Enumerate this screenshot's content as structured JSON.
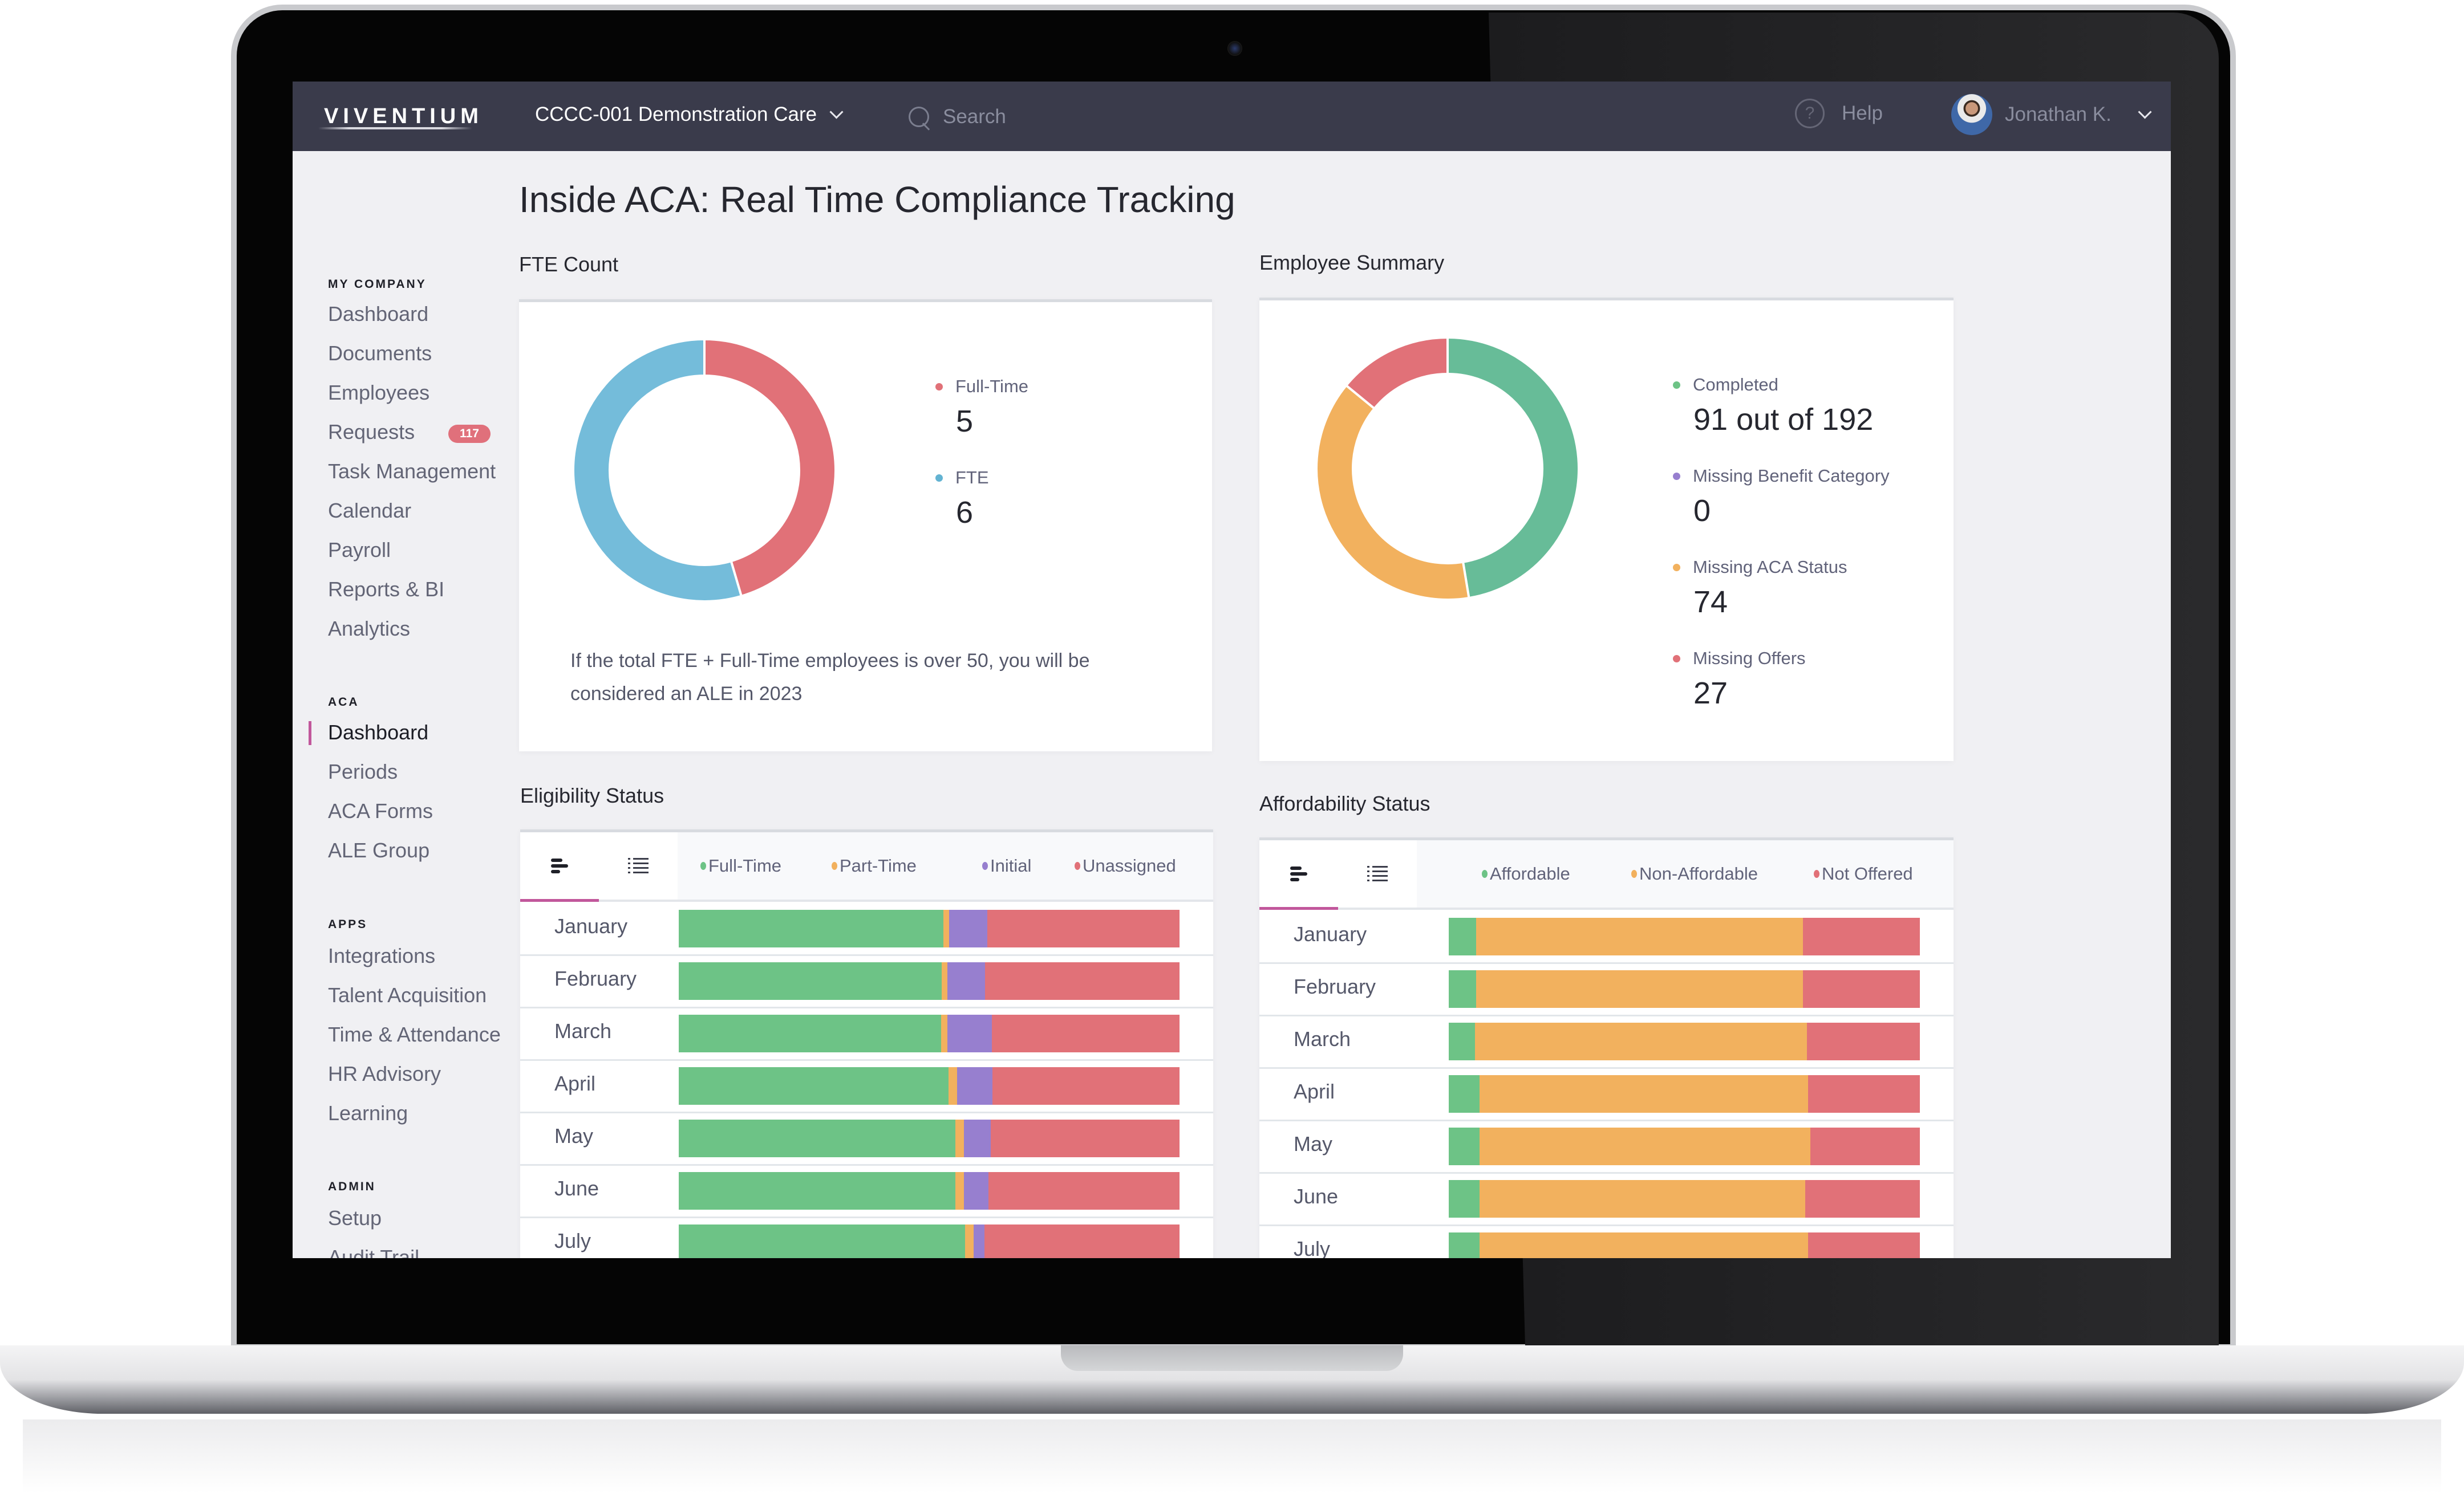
{
  "topnav": {
    "logo": "VIVENTIUM",
    "company": "CCCC-001 Demonstration Care",
    "search_placeholder": "Search",
    "help_label": "Help",
    "user_name": "Jonathan K."
  },
  "sidebar": {
    "sections": [
      {
        "title": "MY COMPANY",
        "items": [
          "Dashboard",
          "Documents",
          "Employees",
          "Requests",
          "Task Management",
          "Calendar",
          "Payroll",
          "Reports & BI",
          "Analytics"
        ]
      },
      {
        "title": "ACA",
        "items": [
          "Dashboard",
          "Periods",
          "ACA Forms",
          "ALE Group"
        ]
      },
      {
        "title": "APPS",
        "items": [
          "Integrations",
          "Talent Acquisition",
          "Time & Attendance",
          "HR Advisory",
          "Learning"
        ]
      },
      {
        "title": "ADMIN",
        "items": [
          "Setup",
          "Audit Trail"
        ]
      }
    ],
    "requests_badge": "117",
    "active_item": "ACA / Dashboard"
  },
  "page": {
    "title": "Inside ACA: Real Time Compliance Tracking"
  },
  "colors": {
    "accent": "#c1579b",
    "green": "#6dc386",
    "teal_green": "#67bc98",
    "orange": "#f2b15e",
    "purple": "#977fcf",
    "red": "#e17178",
    "blue": "#74bcda",
    "nav_bg": "#3a3b4b"
  },
  "fte_count": {
    "title": "FTE Count",
    "legend": [
      {
        "label": "Full-Time",
        "value": "5"
      },
      {
        "label": "FTE",
        "value": "6"
      }
    ],
    "note": "If the total FTE + Full-Time employees is over 50, you will be considered an ALE in 2023"
  },
  "employee_summary": {
    "title": "Employee Summary",
    "legend": [
      {
        "label": "Completed",
        "value": "91 out of 192"
      },
      {
        "label": "Missing Benefit Category",
        "value": "0"
      },
      {
        "label": "Missing ACA Status",
        "value": "74"
      },
      {
        "label": "Missing Offers",
        "value": "27"
      }
    ]
  },
  "eligibility": {
    "title": "Eligibility Status",
    "legend": [
      "Full-Time",
      "Part-Time",
      "Initial",
      "Unassigned"
    ]
  },
  "affordability": {
    "title": "Affordability Status",
    "legend": [
      "Affordable",
      "Non-Affordable",
      "Not Offered"
    ]
  },
  "chart_data": [
    {
      "type": "pie",
      "title": "FTE Count",
      "categories": [
        "Full-Time",
        "FTE"
      ],
      "values": [
        5,
        6
      ],
      "colors": [
        "#e17178",
        "#74bcda"
      ],
      "donut": true
    },
    {
      "type": "pie",
      "title": "Employee Summary",
      "categories": [
        "Completed",
        "Missing Benefit Category",
        "Missing ACA Status",
        "Missing Offers"
      ],
      "values": [
        91,
        0,
        74,
        27
      ],
      "colors": [
        "#67bc98",
        "#977fcf",
        "#f2b15e",
        "#e17178"
      ],
      "donut": true
    },
    {
      "type": "bar",
      "orientation": "horizontal-stacked-percent",
      "title": "Eligibility Status",
      "categories": [
        "January",
        "February",
        "March",
        "April",
        "May",
        "June",
        "July"
      ],
      "series": [
        {
          "name": "Full-Time",
          "color": "#6dc386",
          "values": [
            52.9,
            52.5,
            52.4,
            53.9,
            55.2,
            55.2,
            57.2
          ]
        },
        {
          "name": "Part-Time",
          "color": "#f2b15e",
          "values": [
            1.1,
            1.2,
            1.2,
            1.7,
            1.7,
            1.7,
            1.7
          ]
        },
        {
          "name": "Initial",
          "color": "#977fcf",
          "values": [
            7.6,
            7.5,
            8.9,
            7.1,
            5.4,
            4.9,
            2.2
          ]
        },
        {
          "name": "Unassigned",
          "color": "#e17178",
          "values": [
            38.4,
            38.8,
            37.5,
            37.3,
            37.7,
            38.2,
            38.9
          ]
        }
      ],
      "legend": "top"
    },
    {
      "type": "bar",
      "orientation": "horizontal-stacked-percent",
      "title": "Affordability Status",
      "categories": [
        "January",
        "February",
        "March",
        "April",
        "May",
        "June",
        "July"
      ],
      "series": [
        {
          "name": "Affordable",
          "color": "#6dc386",
          "values": [
            5.8,
            5.8,
            5.6,
            6.5,
            6.5,
            6.5,
            6.5
          ]
        },
        {
          "name": "Non-Affordable",
          "color": "#f2b15e",
          "values": [
            69.4,
            69.4,
            70.4,
            69.8,
            70.2,
            69.2,
            69.8
          ]
        },
        {
          "name": "Not Offered",
          "color": "#e17178",
          "values": [
            24.8,
            24.8,
            24.0,
            23.7,
            23.3,
            24.3,
            23.7
          ]
        }
      ],
      "legend": "top"
    }
  ]
}
